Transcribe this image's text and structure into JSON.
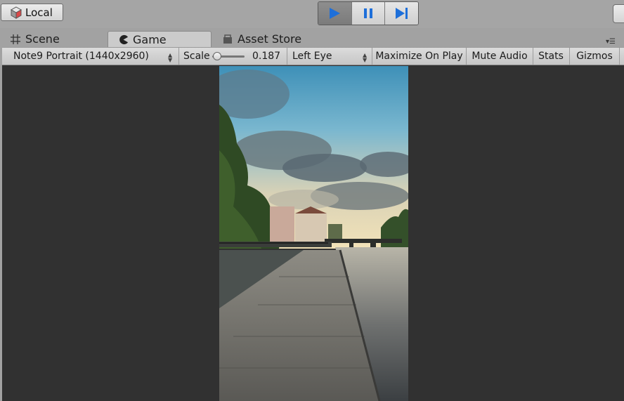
{
  "toolbar": {
    "local_label": "Local"
  },
  "tabs": {
    "scene": "Scene",
    "game": "Game",
    "asset_store": "Asset Store"
  },
  "game_toolbar": {
    "resolution": "Note9 Portrait (1440x2960)",
    "scale_label": "Scale",
    "scale_value": 0.187,
    "eye": "Left Eye",
    "maximize": "Maximize On Play",
    "mute": "Mute Audio",
    "stats": "Stats",
    "gizmos": "Gizmos"
  },
  "colors": {
    "play_blue": "#1e6fd9",
    "view_bg": "#313131"
  },
  "icons": [
    "cube-icon",
    "play-icon",
    "pause-icon",
    "step-icon",
    "grid-icon",
    "pacman-icon",
    "store-icon",
    "panel-menu-icon"
  ]
}
